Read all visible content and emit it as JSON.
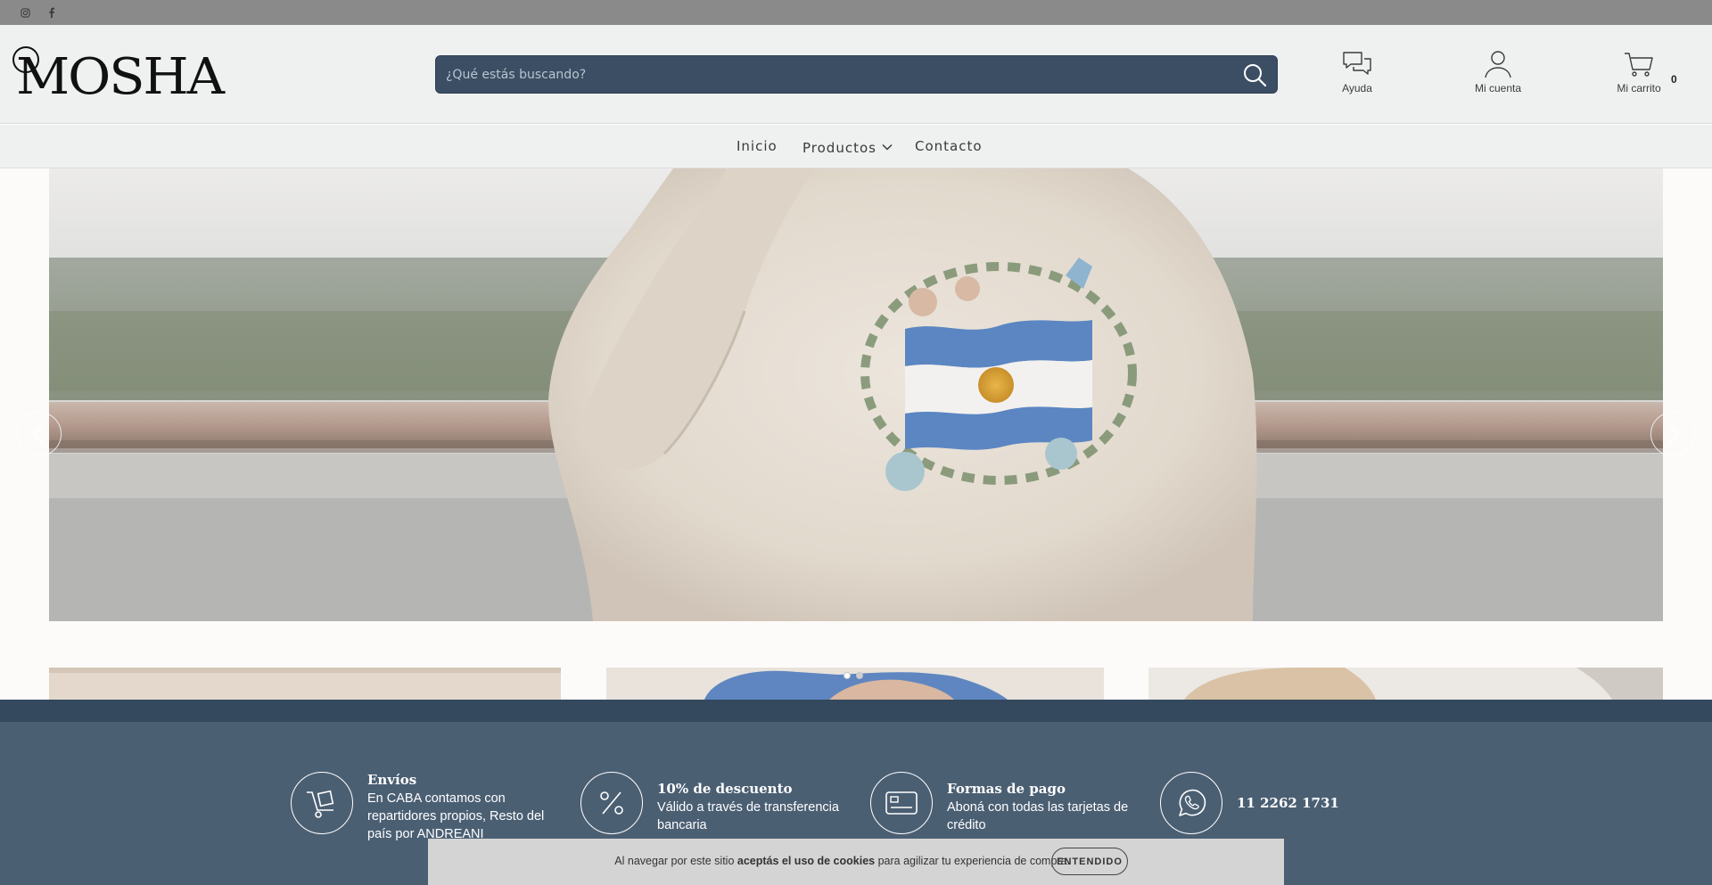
{
  "topbar": {
    "social": [
      {
        "name": "instagram-icon"
      },
      {
        "name": "facebook-icon"
      }
    ]
  },
  "header": {
    "logo_text": "MOSHA",
    "search": {
      "placeholder": "¿Qué estás buscando?"
    },
    "help_label": "Ayuda",
    "account_label": "Mi cuenta",
    "cart_label": "Mi carrito",
    "cart_count": "0"
  },
  "nav": {
    "items": [
      {
        "label": "Inicio"
      },
      {
        "label": "Productos"
      },
      {
        "label": "Contacto"
      }
    ]
  },
  "slider": {
    "active_slide": 1,
    "total_slides": 2
  },
  "features": [
    {
      "icon": "delivery-cart-icon",
      "title": "Envíos",
      "desc": "En CABA contamos con repartidores propios, Resto del país por ANDREANI"
    },
    {
      "icon": "percent-icon",
      "title": "10% de descuento",
      "desc": "Válido a través de transferencia bancaria"
    },
    {
      "icon": "credit-card-icon",
      "title": "Formas de pago",
      "desc": "Aboná con todas las tarjetas de crédito"
    },
    {
      "icon": "whatsapp-icon",
      "title": "11 2262 1731",
      "desc": ""
    }
  ],
  "cookie": {
    "text_before": "Al navegar por este sitio ",
    "text_bold": "aceptás el uso de cookies",
    "text_after": " para agilizar tu experiencia de compra.",
    "button_label": "ENTENDIDO"
  },
  "colors": {
    "topbar": "#8a8a8a",
    "header_bg": "#eff1f1",
    "search_bg": "#3b4e64",
    "footer_band": "#34495e",
    "footer_bg": "#4b5f73",
    "cookie_bg": "#d4d4d4"
  }
}
